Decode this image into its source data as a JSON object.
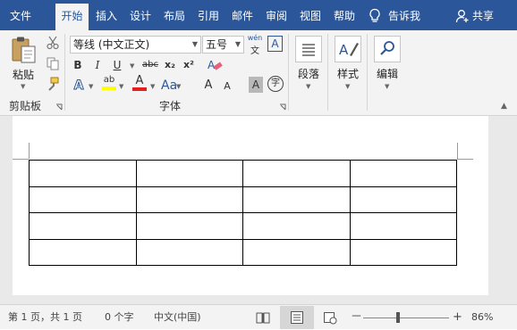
{
  "menu": {
    "items": [
      {
        "label": "文件"
      },
      {
        "label": "开始"
      },
      {
        "label": "插入"
      },
      {
        "label": "设计"
      },
      {
        "label": "布局"
      },
      {
        "label": "引用"
      },
      {
        "label": "邮件"
      },
      {
        "label": "审阅"
      },
      {
        "label": "视图"
      },
      {
        "label": "帮助"
      }
    ],
    "active": "开始",
    "tell_me": "告诉我",
    "share": "共享"
  },
  "ribbon": {
    "clipboard": {
      "paste_label": "粘贴",
      "group_label": "剪贴板"
    },
    "font": {
      "font_name": "等线 (中文正文)",
      "font_size": "五号",
      "phonetic_top": "wén",
      "phonetic_bottom": "文",
      "char_border": "A",
      "bold": "B",
      "italic": "I",
      "underline": "U",
      "strike": "abc",
      "subscript": "x₂",
      "superscript": "x²",
      "grow": "A",
      "shrink": "A",
      "shade": "A",
      "enclose": "字",
      "text_effect": "A",
      "highlight": "ab",
      "font_color": "A",
      "group_label": "字体"
    },
    "paragraph": {
      "label": "段落"
    },
    "styles": {
      "label": "样式"
    },
    "editing": {
      "label": "编辑"
    }
  },
  "document": {
    "table_rows": 4,
    "table_cols": 4
  },
  "status": {
    "page": "第 1 页，共 1 页",
    "words": "0 个字",
    "language": "中文(中国)",
    "zoom": "86%",
    "zoom_minus": "－",
    "zoom_plus": "+"
  },
  "colors": {
    "brand": "#2b579a",
    "highlight": "#ffff00",
    "font_color": "#e02020",
    "ribbon_bg": "#f3f3f3"
  }
}
